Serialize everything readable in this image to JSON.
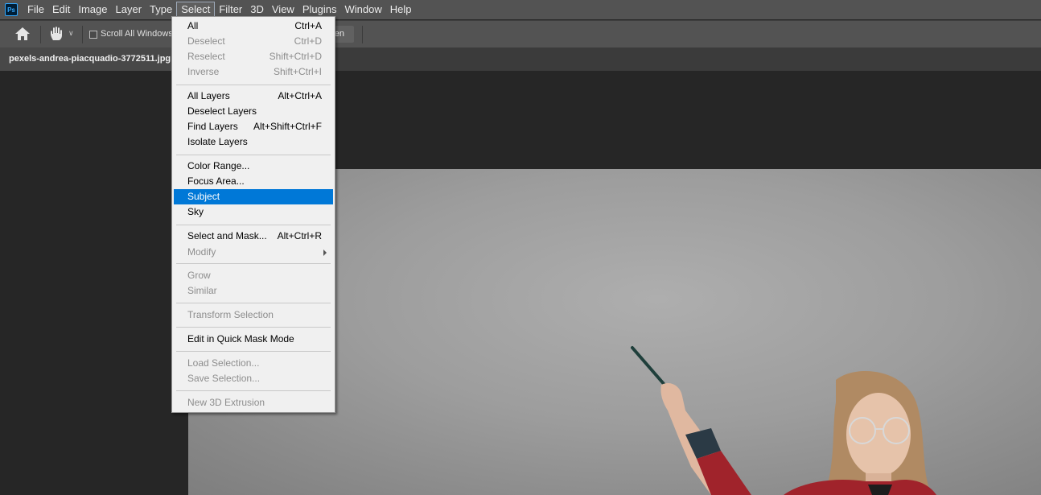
{
  "app": {
    "logo_text": "Ps"
  },
  "menubar": {
    "items": [
      "File",
      "Edit",
      "Image",
      "Layer",
      "Type",
      "Select",
      "Filter",
      "3D",
      "View",
      "Plugins",
      "Window",
      "Help"
    ],
    "active": "Select"
  },
  "options": {
    "scroll_all_windows_label": "Scroll All Windows",
    "scroll_all_windows_checked": false,
    "partial_button_label": "en"
  },
  "document": {
    "tab_title": "pexels-andrea-piacquadio-3772511.jpg"
  },
  "select_menu": {
    "items": [
      {
        "label": "All",
        "shortcut": "Ctrl+A",
        "enabled": true
      },
      {
        "label": "Deselect",
        "shortcut": "Ctrl+D",
        "enabled": false
      },
      {
        "label": "Reselect",
        "shortcut": "Shift+Ctrl+D",
        "enabled": false
      },
      {
        "label": "Inverse",
        "shortcut": "Shift+Ctrl+I",
        "enabled": false
      },
      {
        "label": "All Layers",
        "shortcut": "Alt+Ctrl+A",
        "enabled": true
      },
      {
        "label": "Deselect Layers",
        "shortcut": "",
        "enabled": true
      },
      {
        "label": "Find Layers",
        "shortcut": "Alt+Shift+Ctrl+F",
        "enabled": true
      },
      {
        "label": "Isolate Layers",
        "shortcut": "",
        "enabled": true
      },
      {
        "label": "Color Range...",
        "shortcut": "",
        "enabled": true
      },
      {
        "label": "Focus Area...",
        "shortcut": "",
        "enabled": true
      },
      {
        "label": "Subject",
        "shortcut": "",
        "enabled": true,
        "highlighted": true
      },
      {
        "label": "Sky",
        "shortcut": "",
        "enabled": true
      },
      {
        "label": "Select and Mask...",
        "shortcut": "Alt+Ctrl+R",
        "enabled": true
      },
      {
        "label": "Modify",
        "shortcut": "",
        "enabled": false,
        "submenu": true
      },
      {
        "label": "Grow",
        "shortcut": "",
        "enabled": false
      },
      {
        "label": "Similar",
        "shortcut": "",
        "enabled": false
      },
      {
        "label": "Transform Selection",
        "shortcut": "",
        "enabled": false
      },
      {
        "label": "Edit in Quick Mask Mode",
        "shortcut": "",
        "enabled": true
      },
      {
        "label": "Load Selection...",
        "shortcut": "",
        "enabled": false
      },
      {
        "label": "Save Selection...",
        "shortcut": "",
        "enabled": false
      },
      {
        "label": "New 3D Extrusion",
        "shortcut": "",
        "enabled": false
      }
    ]
  },
  "colors": {
    "highlight": "#0078d7",
    "menubar_bg": "#535353",
    "canvas_bg": "#262626",
    "menu_bg": "#f0f0f0"
  }
}
